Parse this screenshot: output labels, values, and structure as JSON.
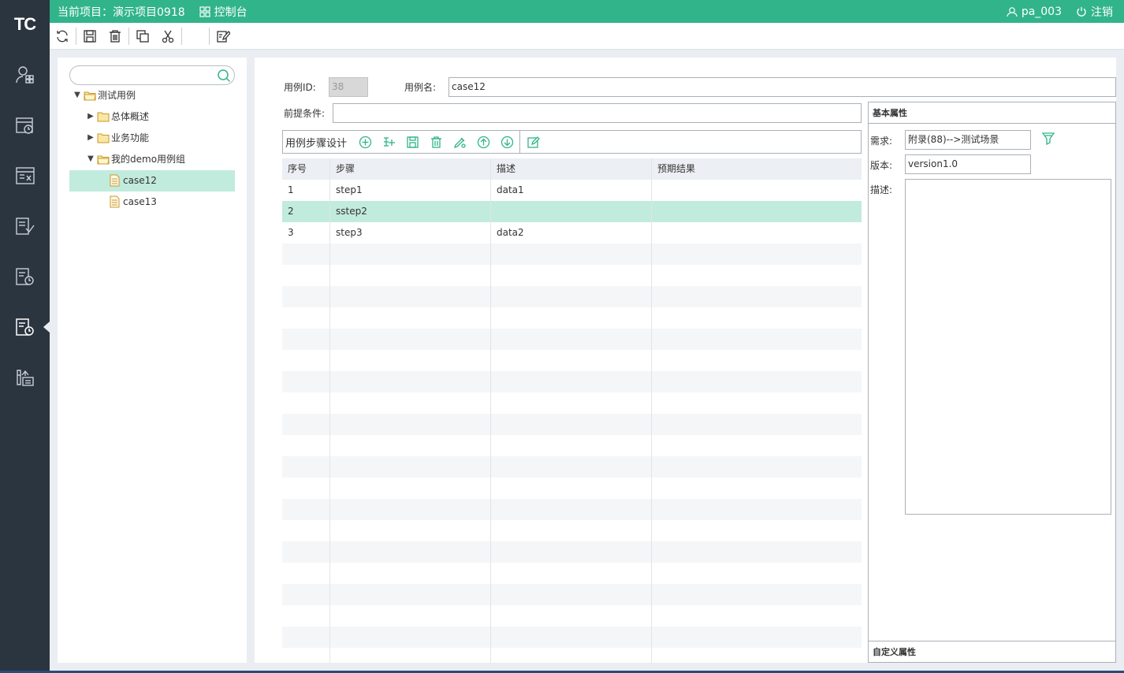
{
  "app": {
    "logo": "TC"
  },
  "header": {
    "project_label": "当前项目：演示项目0918",
    "console_label": "控制台",
    "user_label": "pa_003",
    "logout_label": "注销"
  },
  "toolbar": {
    "items": [
      "refresh-icon",
      "save-icon",
      "delete-icon",
      "copy-icon",
      "cut-icon",
      "edit-icon"
    ]
  },
  "sidenav": {
    "items": [
      "users-icon",
      "schedule-icon",
      "table-icon",
      "checklist-icon",
      "history-icon",
      "case-clock-icon",
      "report-icon"
    ],
    "active_index": 5
  },
  "tree": {
    "search_placeholder": "",
    "root": "测试用例",
    "group1": "总体概述",
    "group2": "业务功能",
    "group3": "我的demo用例组",
    "case1": "case12",
    "case2": "case13"
  },
  "form": {
    "id_label": "用例ID:",
    "id_value": "38",
    "name_label": "用例名:",
    "name_value": "case12",
    "precondition_label": "前提条件:",
    "precondition_value": ""
  },
  "steps": {
    "title": "用例步骤设计",
    "columns": [
      "序号",
      "步骤",
      "描述",
      "预期结果"
    ],
    "rows": [
      [
        "1",
        "step1",
        "data1",
        ""
      ],
      [
        "2",
        "sstep2",
        "",
        ""
      ],
      [
        "3",
        "step3",
        "data2",
        ""
      ]
    ],
    "selected_row": 1
  },
  "props": {
    "header": "基本属性",
    "req_label": "需求:",
    "req_value": "附录(88)-->测试场景",
    "version_label": "版本:",
    "version_value": "version1.0",
    "desc_label": "描述:",
    "desc_value": "",
    "footer": "自定义属性"
  },
  "colors": {
    "accent": "#31b489",
    "sidebar": "#2b3540",
    "selection": "#c1ebdd"
  }
}
